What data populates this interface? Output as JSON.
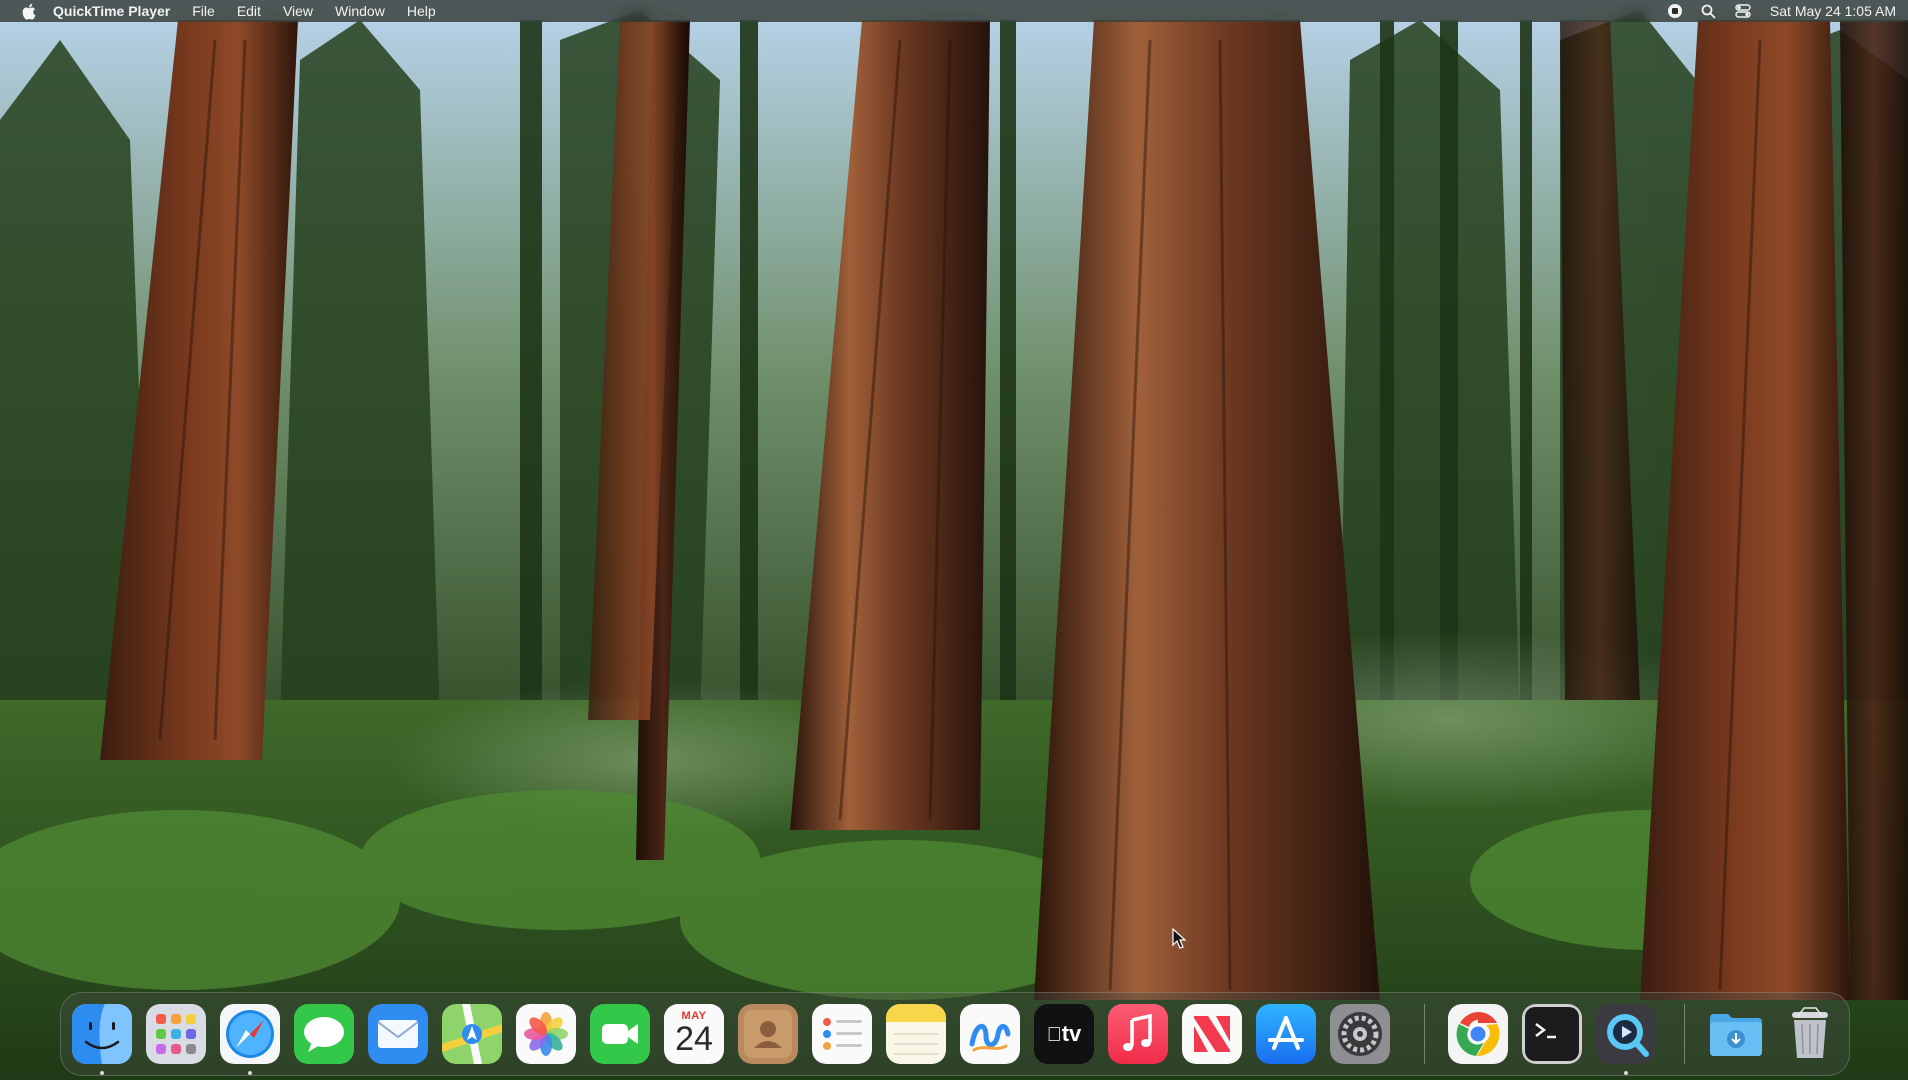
{
  "menubar": {
    "apple_icon": "apple-logo-icon",
    "app_name": "QuickTime Player",
    "menus": [
      "File",
      "Edit",
      "View",
      "Window",
      "Help"
    ],
    "status_icons": [
      "screen-recording-stop-icon",
      "spotlight-search-icon",
      "control-center-icon"
    ],
    "clock": "Sat May 24  1:05 AM"
  },
  "dock": {
    "apps": [
      {
        "name": "Finder",
        "icon": "finder-icon",
        "running": true
      },
      {
        "name": "Launchpad",
        "icon": "launchpad-icon",
        "running": false
      },
      {
        "name": "Safari",
        "icon": "safari-icon",
        "running": true
      },
      {
        "name": "Messages",
        "icon": "messages-icon",
        "running": false
      },
      {
        "name": "Mail",
        "icon": "mail-icon",
        "running": false
      },
      {
        "name": "Maps",
        "icon": "maps-icon",
        "running": false
      },
      {
        "name": "Photos",
        "icon": "photos-icon",
        "running": false
      },
      {
        "name": "FaceTime",
        "icon": "facetime-icon",
        "running": false
      },
      {
        "name": "Calendar",
        "icon": "calendar-icon",
        "running": false,
        "month": "MAY",
        "day": "24"
      },
      {
        "name": "Contacts",
        "icon": "contacts-icon",
        "running": false
      },
      {
        "name": "Reminders",
        "icon": "reminders-icon",
        "running": false
      },
      {
        "name": "Notes",
        "icon": "notes-icon",
        "running": false
      },
      {
        "name": "Freeform",
        "icon": "freeform-icon",
        "running": false
      },
      {
        "name": "TV",
        "icon": "apple-tv-icon",
        "running": false,
        "label": "tv"
      },
      {
        "name": "Music",
        "icon": "music-icon",
        "running": false
      },
      {
        "name": "News",
        "icon": "news-icon",
        "running": false
      },
      {
        "name": "App Store",
        "icon": "app-store-icon",
        "running": false
      },
      {
        "name": "System Settings",
        "icon": "system-settings-icon",
        "running": false
      },
      {
        "name": "Chrome",
        "icon": "chrome-icon",
        "running": false
      },
      {
        "name": "Terminal",
        "icon": "terminal-icon",
        "running": false
      },
      {
        "name": "QuickTime Player",
        "icon": "quicktime-icon",
        "running": true
      },
      {
        "name": "Downloads",
        "icon": "downloads-folder-icon",
        "running": false
      },
      {
        "name": "Trash",
        "icon": "trash-icon",
        "running": false
      }
    ]
  },
  "colors": {
    "menubar_bg": "#22281e",
    "dock_bg": "#46504626",
    "calendar_month": "#e0352b"
  }
}
